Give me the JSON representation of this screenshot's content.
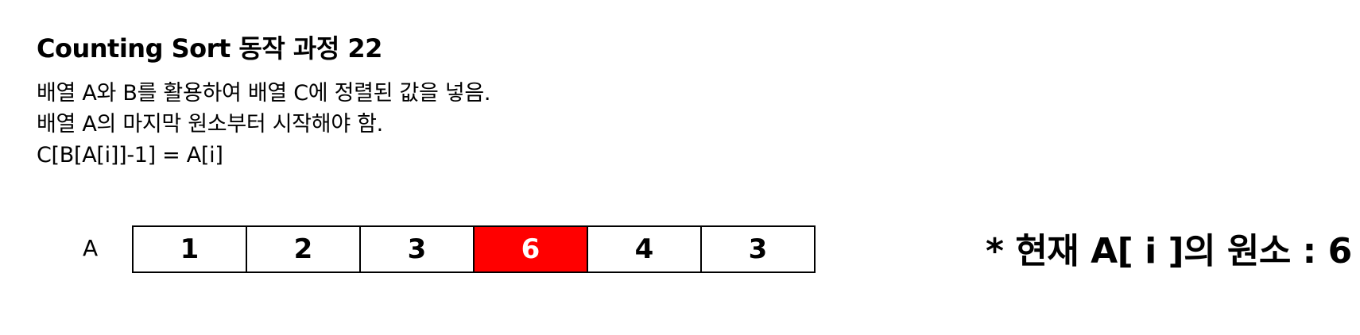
{
  "title": "Counting Sort 동작 과정 22",
  "description": [
    "배열 A와 B를 활용하여 배열 C에 정렬된 값을 넣음.",
    "배열 A의 마지막 원소부터 시작해야 함.",
    "C[B[A[i]]-1] = A[i]"
  ],
  "array": {
    "label": "A",
    "values": [
      "1",
      "2",
      "3",
      "6",
      "4",
      "3"
    ],
    "highlight_index": 3
  },
  "note": "* 현재 A[ i ]의 원소 : 6",
  "colors": {
    "highlight_background": "#ff0000",
    "highlight_text": "#ffffff"
  }
}
